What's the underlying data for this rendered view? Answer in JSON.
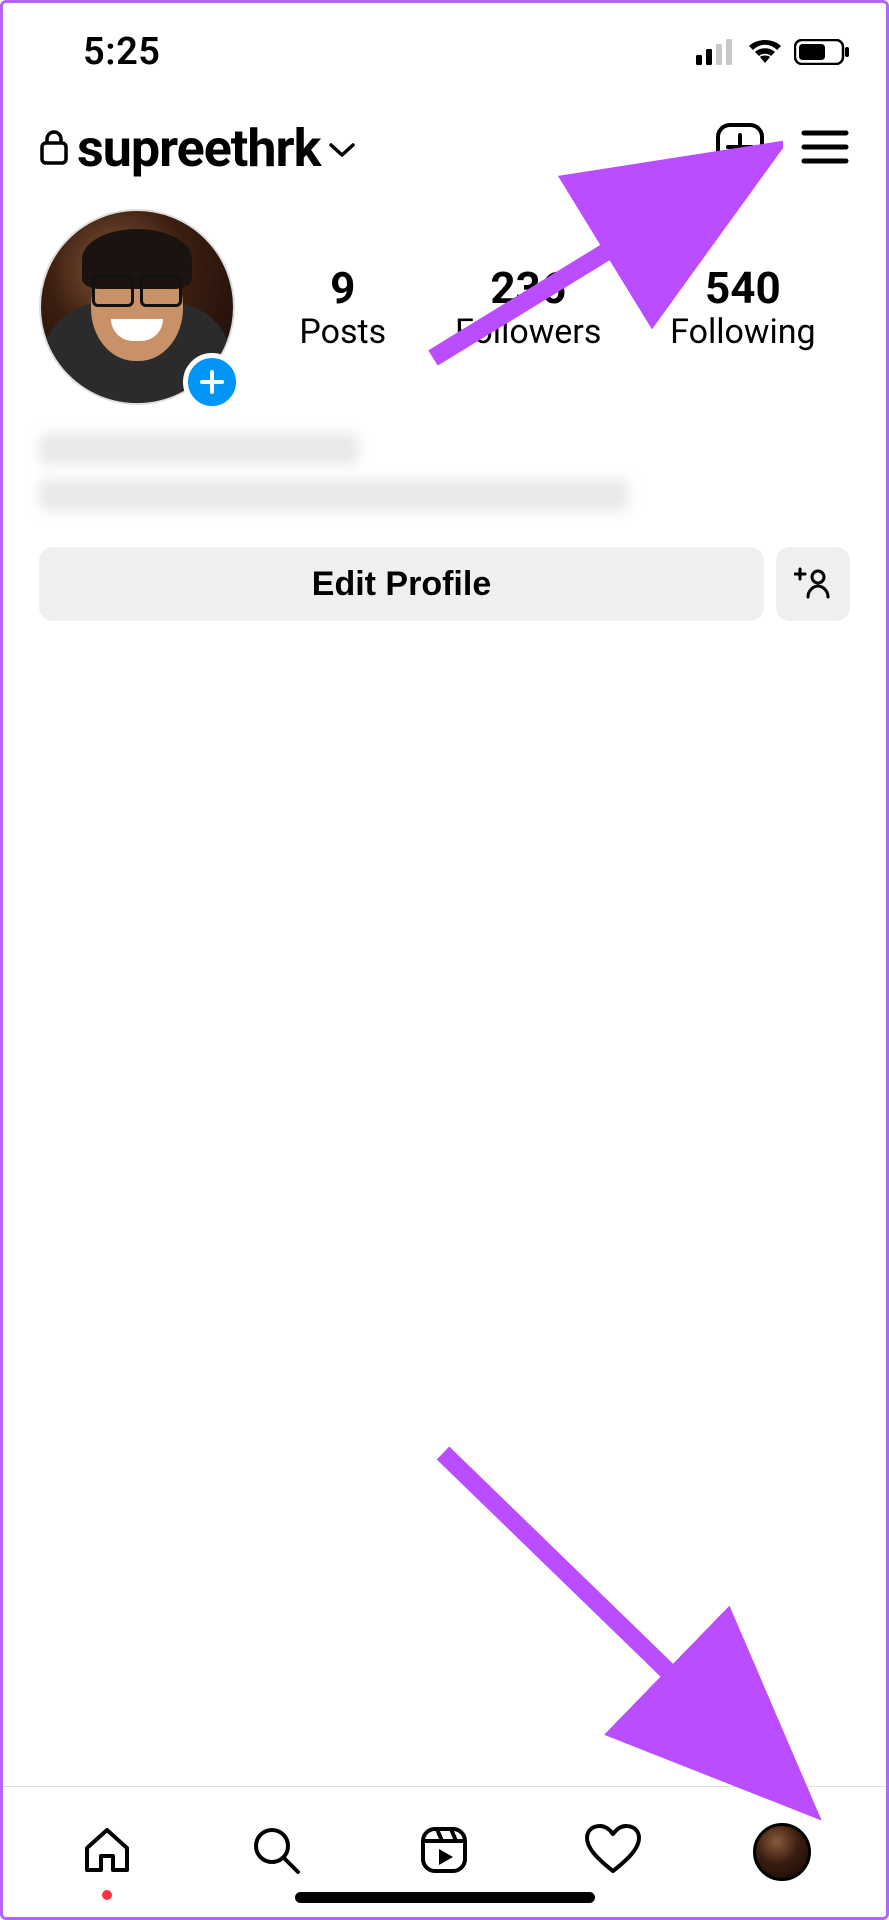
{
  "status": {
    "time": "5:25"
  },
  "header": {
    "username": "supreethrk"
  },
  "stats": {
    "posts": {
      "count": "9",
      "label": "Posts"
    },
    "followers": {
      "count": "236",
      "label": "Followers"
    },
    "following": {
      "count": "540",
      "label": "Following"
    }
  },
  "actions": {
    "edit_profile": "Edit Profile"
  },
  "annotation": {
    "arrow_color": "#b94dff"
  }
}
